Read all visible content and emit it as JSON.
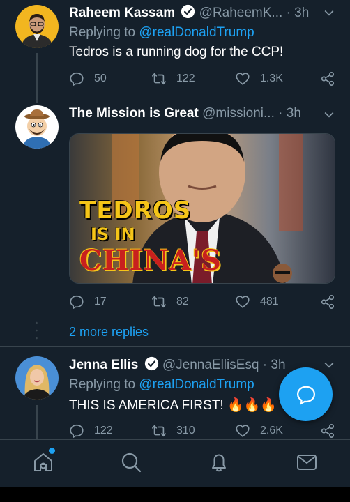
{
  "tweets": [
    {
      "name": "Raheem Kassam",
      "handle": "@RaheemK...",
      "time": "· 3h",
      "replying_prefix": "Replying to",
      "replying_to": "@realDonaldTrump",
      "text": "Tedros is a running dog for the CCP!",
      "replies": "50",
      "retweets": "122",
      "likes": "1.3K"
    },
    {
      "name": "The Mission is Great",
      "handle": "@missioni...",
      "time": "· 3h",
      "media_text": [
        "TEDROS",
        "IS IN",
        "CHINA'S"
      ],
      "replies": "17",
      "retweets": "82",
      "likes": "481"
    },
    {
      "name": "Jenna Ellis",
      "handle": "@JennaEllisEsq",
      "time": "· 3h",
      "replying_prefix": "Replying to",
      "replying_to": "@realDonaldTrump",
      "text": "THIS IS AMERICA FIRST!",
      "emoji": "🔥🔥🔥",
      "replies": "122",
      "retweets": "310",
      "likes": "2.6K"
    }
  ],
  "more_replies": "2 more replies",
  "colors": {
    "background": "#15202b",
    "accent": "#1da1f2",
    "muted": "#8899a6",
    "divider": "#38444d"
  },
  "icons": [
    "verified-badge-icon",
    "chevron-down-icon",
    "reply-icon",
    "retweet-icon",
    "like-icon",
    "share-icon",
    "compose-reply-icon",
    "home-icon",
    "search-icon",
    "notifications-icon",
    "messages-icon"
  ]
}
